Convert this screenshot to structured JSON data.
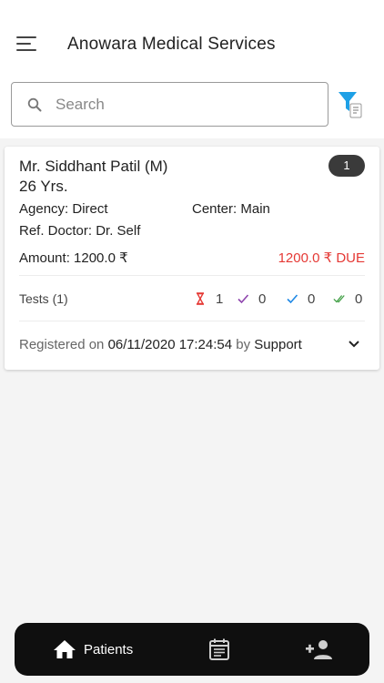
{
  "header": {
    "title": "Anowara Medical Services",
    "menu_icon": "hamburger-menu-icon"
  },
  "search": {
    "placeholder": "Search",
    "value": ""
  },
  "filter": {
    "icon": "filter-icon",
    "color": "#1ea0e6"
  },
  "patients": [
    {
      "name": "Mr. Siddhant Patil (M)",
      "age": "26 Yrs.",
      "badge": "1",
      "agency": "Agency: Direct",
      "center": "Center: Main",
      "ref_doctor": "Ref. Doctor: Dr. Self",
      "amount": "Amount: 1200.0 ₹",
      "due": "1200.0 ₹ DUE",
      "tests_label": "Tests (1)",
      "stats": {
        "pending": "1",
        "approved": "0",
        "checked": "0",
        "completed": "0"
      },
      "registered_prefix": "Registered on",
      "registered_date": "06/11/2020 17:24:54",
      "registered_by_word": "by",
      "registered_by": "Support"
    }
  ],
  "nav": {
    "patients_label": "Patients",
    "items": [
      "home-icon",
      "calendar-icon",
      "add-person-icon"
    ]
  },
  "colors": {
    "due": "#e53935",
    "pending": "#e53935",
    "approved": "#8e44ad",
    "checked": "#1e88e5",
    "completed": "#43a047",
    "nav_bg": "#0f0f0f"
  }
}
